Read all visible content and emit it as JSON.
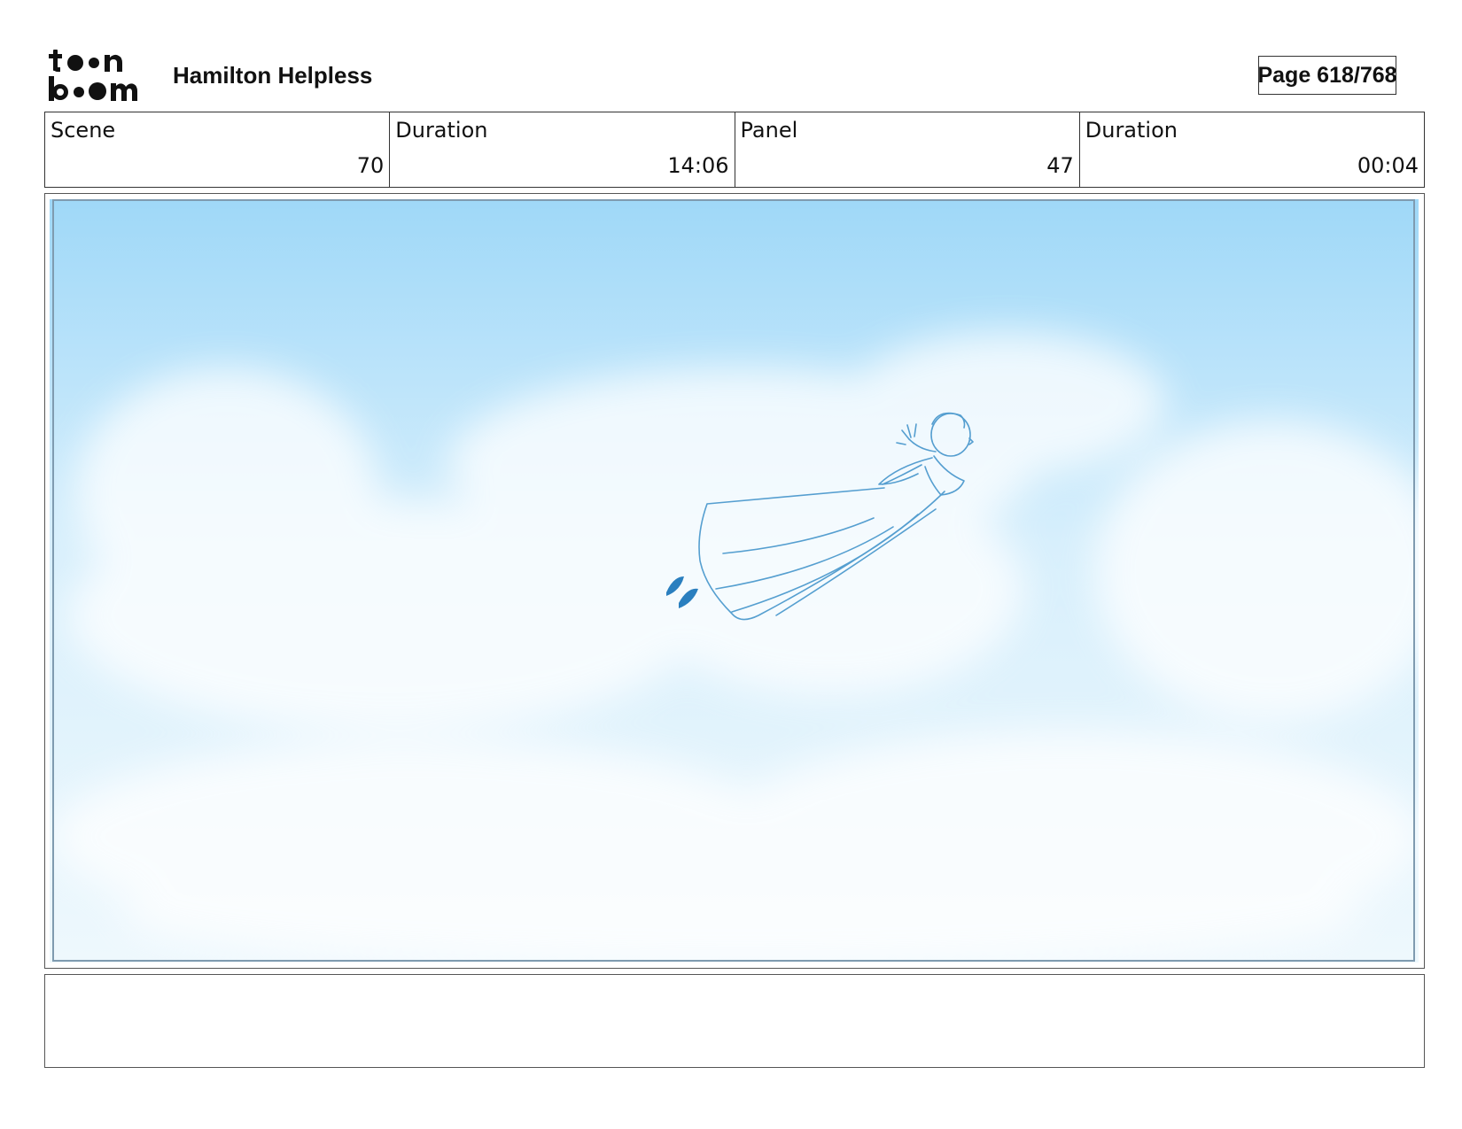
{
  "header": {
    "logo_text": "toon boom",
    "project_title": "Hamilton Helpless",
    "page_label": "Page 618/768"
  },
  "info": [
    {
      "label": "Scene",
      "value": "70"
    },
    {
      "label": "Duration",
      "value": "14:06"
    },
    {
      "label": "Panel",
      "value": "47"
    },
    {
      "label": "Duration",
      "value": "00:04"
    }
  ],
  "panel": {
    "sky_top_color": "#9fd8f8",
    "sky_bottom_color": "#eef8fd",
    "sketch_color": "#3a8fc8"
  },
  "notes": {
    "text": ""
  }
}
